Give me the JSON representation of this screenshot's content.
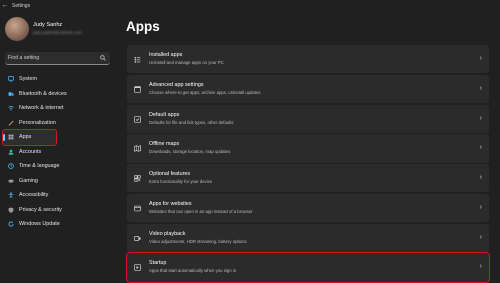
{
  "window": {
    "title": "Settings"
  },
  "user": {
    "name": "Judy Sanhz",
    "email": "judy.sanhz@outlook.com"
  },
  "search": {
    "placeholder": "Find a setting"
  },
  "sidebar": {
    "items": [
      {
        "label": "System",
        "icon": "monitor-icon",
        "color": "#4cc2ff"
      },
      {
        "label": "Bluetooth & devices",
        "icon": "bluetooth-icon",
        "color": "#4cc2ff"
      },
      {
        "label": "Network & internet",
        "icon": "wifi-icon",
        "color": "#4cc2ff"
      },
      {
        "label": "Personalization",
        "icon": "brush-icon",
        "color": "#e8a15c"
      },
      {
        "label": "Apps",
        "icon": "apps-icon",
        "color": "#b0b0b0",
        "selected": true
      },
      {
        "label": "Accounts",
        "icon": "person-icon",
        "color": "#3fb68b"
      },
      {
        "label": "Time & language",
        "icon": "clock-icon",
        "color": "#4cc2ff"
      },
      {
        "label": "Gaming",
        "icon": "controller-icon",
        "color": "#b0b0b0"
      },
      {
        "label": "Accessibility",
        "icon": "accessibility-icon",
        "color": "#4cc2ff"
      },
      {
        "label": "Privacy & security",
        "icon": "shield-icon",
        "color": "#9a9a9a"
      },
      {
        "label": "Windows Update",
        "icon": "update-icon",
        "color": "#4cc2ff"
      }
    ]
  },
  "main": {
    "title": "Apps",
    "cards": [
      {
        "title": "Installed apps",
        "desc": "Uninstall and manage apps on your PC",
        "icon": "list-icon"
      },
      {
        "title": "Advanced app settings",
        "desc": "Choose where to get apps, archive apps, uninstall updates",
        "icon": "settings-app-icon"
      },
      {
        "title": "Default apps",
        "desc": "Defaults for file and link types, other defaults",
        "icon": "default-apps-icon"
      },
      {
        "title": "Offline maps",
        "desc": "Downloads, storage location, map updates",
        "icon": "map-icon"
      },
      {
        "title": "Optional features",
        "desc": "Extra functionality for your device",
        "icon": "optional-features-icon"
      },
      {
        "title": "Apps for websites",
        "desc": "Websites that can open in an app instead of a browser",
        "icon": "web-apps-icon"
      },
      {
        "title": "Video playback",
        "desc": "Video adjustments, HDR streaming, battery options",
        "icon": "video-icon"
      },
      {
        "title": "Startup",
        "desc": "Apps that start automatically when you sign in",
        "icon": "startup-icon"
      }
    ]
  },
  "colors": {
    "background": "#202020",
    "card": "#2b2b2b",
    "accent": "#60cdff",
    "highlight_box": "#d01821"
  }
}
